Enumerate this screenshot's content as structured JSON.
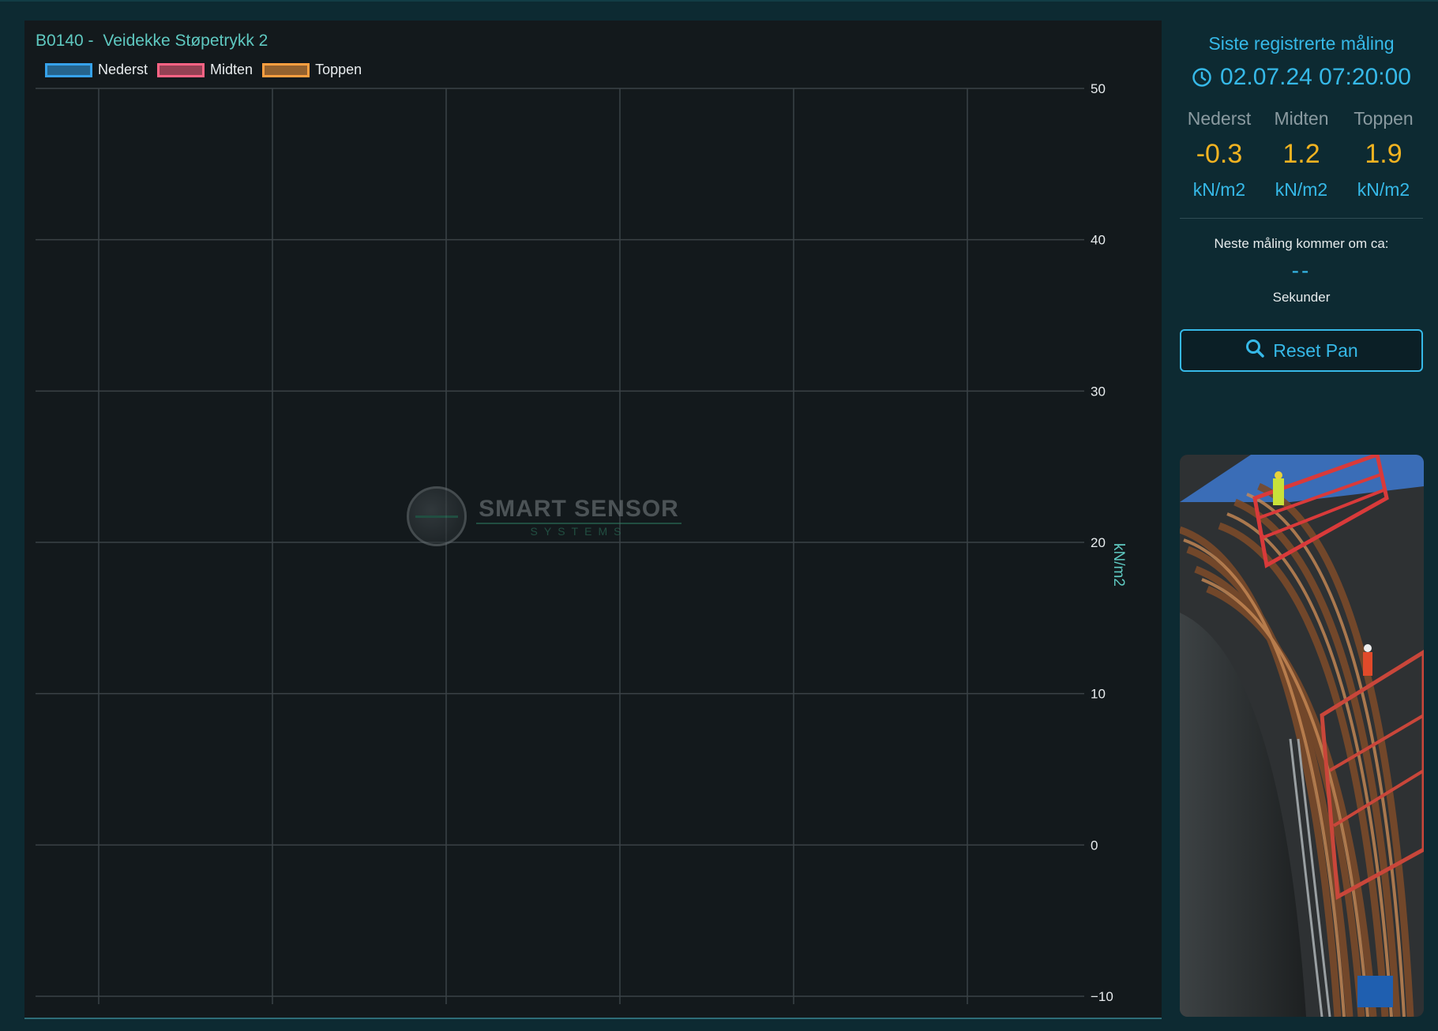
{
  "chart": {
    "title_code": "B0140 -",
    "title_name": "Veidekke Støpetrykk 2",
    "y_axis_label": "kN/m2",
    "watermark": {
      "main": "SMART SENSOR",
      "sub": "SYSTEMS"
    }
  },
  "chart_data": {
    "type": "line",
    "title": "B0140 - Veidekke Støpetrykk 2",
    "xlabel": "",
    "ylabel": "kN/m2",
    "ylim": [
      -10,
      50
    ],
    "y_ticks": [
      "50",
      "40",
      "30",
      "20",
      "10",
      "0",
      "−10"
    ],
    "grid": true,
    "legend_position": "top-left",
    "y_axis_side": "right",
    "series": [
      {
        "name": "Nederst",
        "color": "#36a2eb",
        "values": []
      },
      {
        "name": "Midten",
        "color": "#ff6384",
        "values": []
      },
      {
        "name": "Toppen",
        "color": "#ff9f40",
        "values": []
      }
    ]
  },
  "sidebar": {
    "title": "Siste registrerte måling",
    "timestamp": "02.07.24 07:20:00",
    "clock_icon": "clock-icon",
    "readings": [
      {
        "label": "Nederst",
        "value": "-0.3",
        "unit": "kN/m2"
      },
      {
        "label": "Midten",
        "value": "1.2",
        "unit": "kN/m2"
      },
      {
        "label": "Toppen",
        "value": "1.9",
        "unit": "kN/m2"
      }
    ],
    "next_label": "Neste måling kommer om ca:",
    "next_value": "--",
    "next_unit": "Sekunder",
    "reset_button": "Reset Pan",
    "reset_icon": "search-icon",
    "photo_icon": "construction-site-photo"
  },
  "colors": {
    "accent": "#36b9e8",
    "teal_text": "#5fc9c1",
    "value": "#f2b321",
    "panel_bg": "#13191c",
    "page_bg": "#0d2a32"
  }
}
